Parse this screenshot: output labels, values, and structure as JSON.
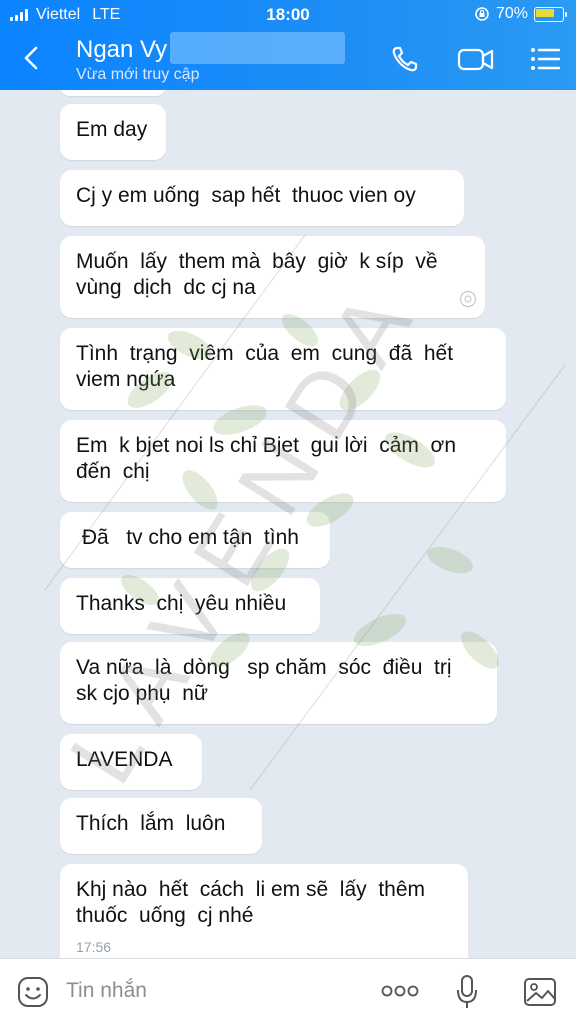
{
  "status_bar": {
    "carrier": "Viettel",
    "network": "LTE",
    "time": "18:00",
    "battery": "70%"
  },
  "header": {
    "contact_name": "Ngan Vy",
    "subtitle": "Vừa mới truy cập",
    "icons": [
      "back-icon",
      "phone-icon",
      "video-call-icon",
      "menu-list-icon"
    ]
  },
  "messages": [
    {
      "text": "Em day"
    },
    {
      "text": "Cj y em uống  sap hết  thuoc vien oy"
    },
    {
      "text": "Muốn  lấy  them mà  bây  giờ  k síp  về\nvùng  dịch  dc cj na"
    },
    {
      "text": "Tình  trạng  viêm  của  em  cung  đã  hết\nviem ngứa"
    },
    {
      "text": "Em  k bjet noi ls chỉ Bjet  gui lời  cảm  ơn\nđến  chị"
    },
    {
      "text": " Đã   tv cho em tận  tình"
    },
    {
      "text": "Thanks  chị  yêu nhiều"
    },
    {
      "text": "Va nữa  là  dòng   sp chăm  sóc  điều  trị\nsk cjo phụ  nữ"
    },
    {
      "text": "LAVENDA"
    },
    {
      "text": "Thích  lắm  luôn"
    },
    {
      "text": "Khj nào  hết  cách  li em sẽ  lấy  thêm\nthuốc  uống  cj nhé",
      "time": "17:56"
    }
  ],
  "watermark": {
    "text": "LAVENDA"
  },
  "composer": {
    "placeholder": "Tin nhắn",
    "icons": [
      "sticker-icon",
      "more-icon",
      "microphone-icon",
      "image-icon"
    ]
  }
}
